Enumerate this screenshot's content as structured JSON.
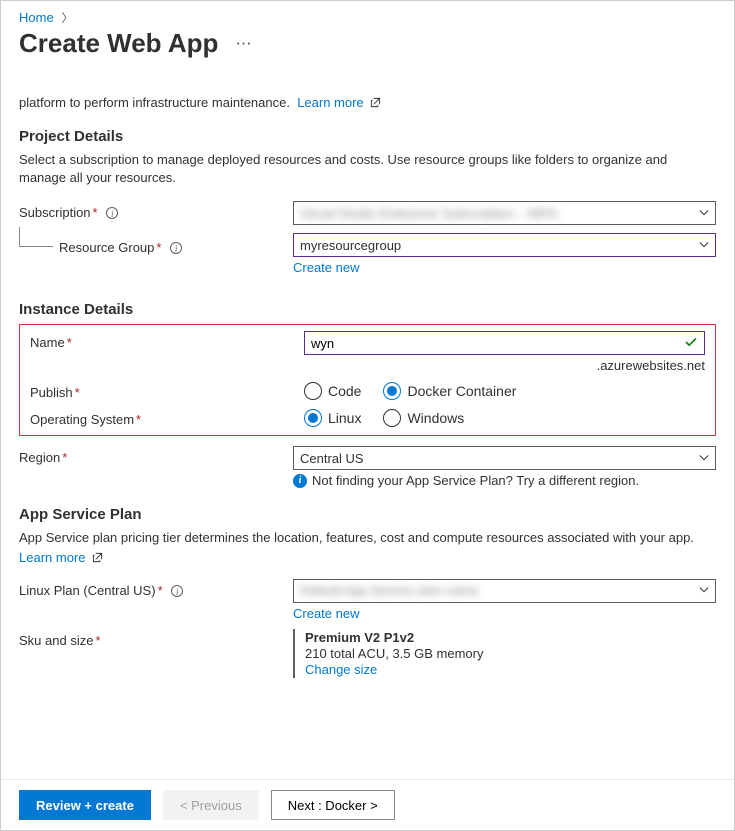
{
  "breadcrumb": {
    "home": "Home"
  },
  "title": "Create Web App",
  "intro_text": "platform to perform infrastructure maintenance.",
  "learn_more": "Learn more",
  "project_details": {
    "heading": "Project Details",
    "desc": "Select a subscription to manage deployed resources and costs. Use resource groups like folders to organize and manage all your resources.",
    "subscription_label": "Subscription",
    "subscription_value": "Visual Studio Enterprise Subscription – MPN",
    "resource_group_label": "Resource Group",
    "resource_group_value": "myresourcegroup",
    "create_new": "Create new"
  },
  "instance_details": {
    "heading": "Instance Details",
    "name_label": "Name",
    "name_value": "wyn",
    "domain_suffix": ".azurewebsites.net",
    "publish_label": "Publish",
    "publish_options": {
      "code": "Code",
      "docker": "Docker Container"
    },
    "os_label": "Operating System",
    "os_options": {
      "linux": "Linux",
      "windows": "Windows"
    },
    "region_label": "Region",
    "region_value": "Central US",
    "region_hint": "Not finding your App Service Plan? Try a different region."
  },
  "app_service_plan": {
    "heading": "App Service Plan",
    "desc": "App Service plan pricing tier determines the location, features, cost and compute resources associated with your app.",
    "linux_plan_label": "Linux Plan (Central US)",
    "linux_plan_value": "Default App Service plan name",
    "create_new": "Create new",
    "sku_label": "Sku and size",
    "sku_name": "Premium V2 P1v2",
    "sku_spec": "210 total ACU, 3.5 GB memory",
    "change_size": "Change size"
  },
  "footer": {
    "review": "Review + create",
    "previous": "< Previous",
    "next": "Next : Docker >"
  }
}
